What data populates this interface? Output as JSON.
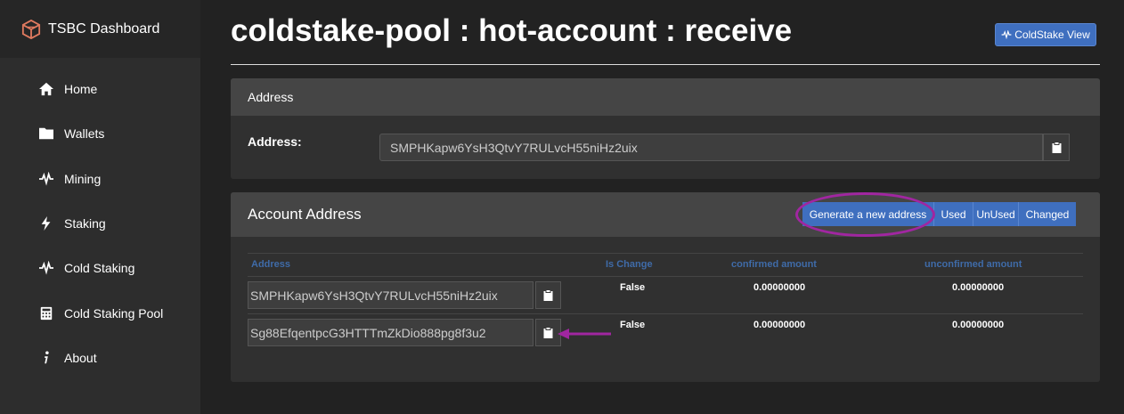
{
  "brand": {
    "name": "TSBC Dashboard",
    "icon": "cube-logo-icon",
    "accent": "#e07a5f"
  },
  "sidebar": {
    "items": [
      {
        "label": "Home",
        "icon": "home-icon"
      },
      {
        "label": "Wallets",
        "icon": "folder-icon"
      },
      {
        "label": "Mining",
        "icon": "pulse-icon"
      },
      {
        "label": "Staking",
        "icon": "bolt-icon"
      },
      {
        "label": "Cold Staking",
        "icon": "pulse-icon"
      },
      {
        "label": "Cold Staking Pool",
        "icon": "calculator-icon"
      },
      {
        "label": "About",
        "icon": "info-icon"
      }
    ]
  },
  "header": {
    "title": "coldstake-pool : hot-account : receive",
    "coldstake_view_label": "ColdStake View"
  },
  "address_panel": {
    "heading": "Address",
    "label": "Address:",
    "value": "SMPHKapw6YsH3QtvY7RULvcH55niHz2uix"
  },
  "account_panel": {
    "heading": "Account Address",
    "buttons": {
      "generate": "Generate a new address",
      "used": "Used",
      "unused": "UnUsed",
      "changed": "Changed"
    },
    "columns": [
      "Address",
      "Is Change",
      "confirmed amount",
      "unconfirmed amount"
    ],
    "rows": [
      {
        "address": "SMPHKapw6YsH3QtvY7RULvcH55niHz2uix",
        "is_change": "False",
        "confirmed": "0.00000000",
        "unconfirmed": "0.00000000"
      },
      {
        "address": "Sg88EfqentpcG3HTTTmZkDio888pg8f3u2",
        "is_change": "False",
        "confirmed": "0.00000000",
        "unconfirmed": "0.00000000"
      }
    ]
  },
  "colors": {
    "primary_button": "#3f6fbf",
    "annotation": "#a126a1",
    "column_header": "#3f6ba8"
  }
}
